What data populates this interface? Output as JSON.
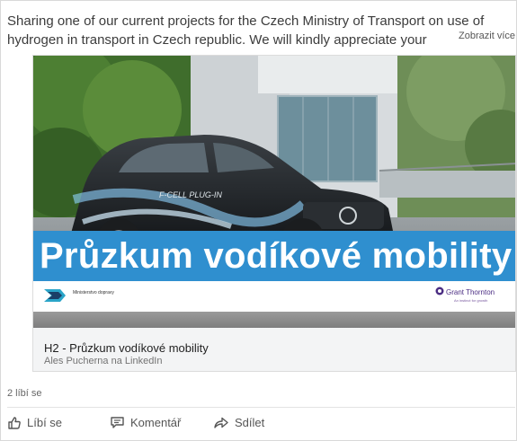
{
  "post": {
    "text_line1": "Sharing one of our current projects for the Czech Ministry of Transport on use of",
    "text_line2": "hydrogen in transport in Czech republic. We will kindly appreciate your",
    "see_more": "Zobrazit více"
  },
  "card": {
    "car_label": "F-CELL PLUG-IN",
    "hero_title": "Průzkum vodíkové mobility",
    "ministry_logo_text": "Ministerstvo dopravy",
    "gt_name": "Grant Thornton",
    "gt_tagline": "An instinct for growth",
    "title": "H2 - Průzkum vodíkové mobility",
    "source": "Ales Pucherna na LinkedIn"
  },
  "social": {
    "likes": "2 líbí se"
  },
  "actions": {
    "like": "Líbí se",
    "comment": "Komentář",
    "share": "Sdílet"
  },
  "colors": {
    "banner_blue": "#2f8fcf",
    "grant_thornton_purple": "#4b2d83"
  },
  "icons": [
    "thumbs-up-icon",
    "comment-icon",
    "share-icon",
    "ministry-logo-icon",
    "grant-thornton-logo-icon"
  ]
}
